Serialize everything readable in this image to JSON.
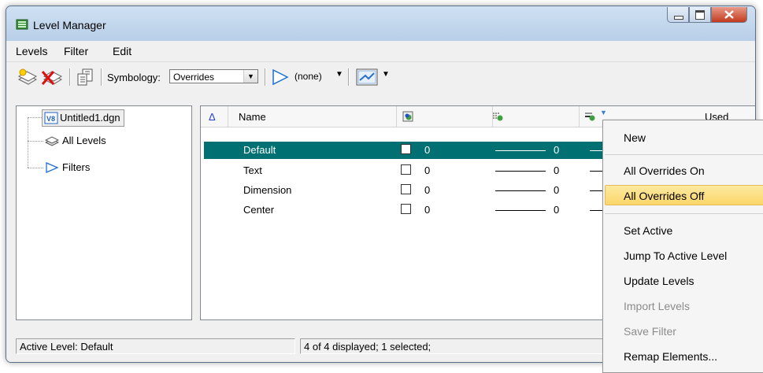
{
  "window": {
    "title": "Level Manager"
  },
  "menubar": {
    "items": [
      {
        "label": "Levels",
        "mnemonic": "L"
      },
      {
        "label": "Filter",
        "mnemonic": "F"
      },
      {
        "label": "Edit",
        "mnemonic": "E"
      }
    ]
  },
  "toolbar": {
    "symbology_label": "Symbology:",
    "symbology_value": "Overrides",
    "filter_value": "(none)"
  },
  "tree": {
    "items": [
      {
        "label": "Untitled1.dgn",
        "icon": "dgn-file-icon"
      },
      {
        "label": "All Levels",
        "icon": "levels-stack-icon"
      },
      {
        "label": "Filters",
        "icon": "filter-icon"
      }
    ]
  },
  "level_table": {
    "columns": [
      "Name",
      "Used"
    ],
    "rows": [
      {
        "name": "Default",
        "color": "0",
        "weight": "0",
        "selected": true
      },
      {
        "name": "Text",
        "color": "0",
        "weight": "0",
        "selected": false
      },
      {
        "name": "Dimension",
        "color": "0",
        "weight": "0",
        "selected": false
      },
      {
        "name": "Center",
        "color": "0",
        "weight": "0",
        "selected": false
      }
    ]
  },
  "status": {
    "active_level": "Active Level: Default",
    "display_info": "4 of 4 displayed; 1 selected;"
  },
  "context_menu": {
    "items": [
      {
        "label": "New",
        "enabled": true
      },
      {
        "label": "All Overrides On",
        "enabled": true
      },
      {
        "label": "All Overrides Off",
        "enabled": true,
        "highlighted": true
      },
      {
        "label": "Set Active",
        "enabled": true
      },
      {
        "label": "Jump To Active Level",
        "enabled": true
      },
      {
        "label": "Update Levels",
        "enabled": true
      },
      {
        "label": "Import Levels",
        "enabled": false
      },
      {
        "label": "Save Filter",
        "enabled": false
      },
      {
        "label": "Remap Elements...",
        "enabled": true
      }
    ]
  },
  "colors": {
    "selection": "#007073",
    "menu_highlight": "#fbd66a",
    "titlebar": "#b8cfe8",
    "close_button": "#c23a1e"
  }
}
